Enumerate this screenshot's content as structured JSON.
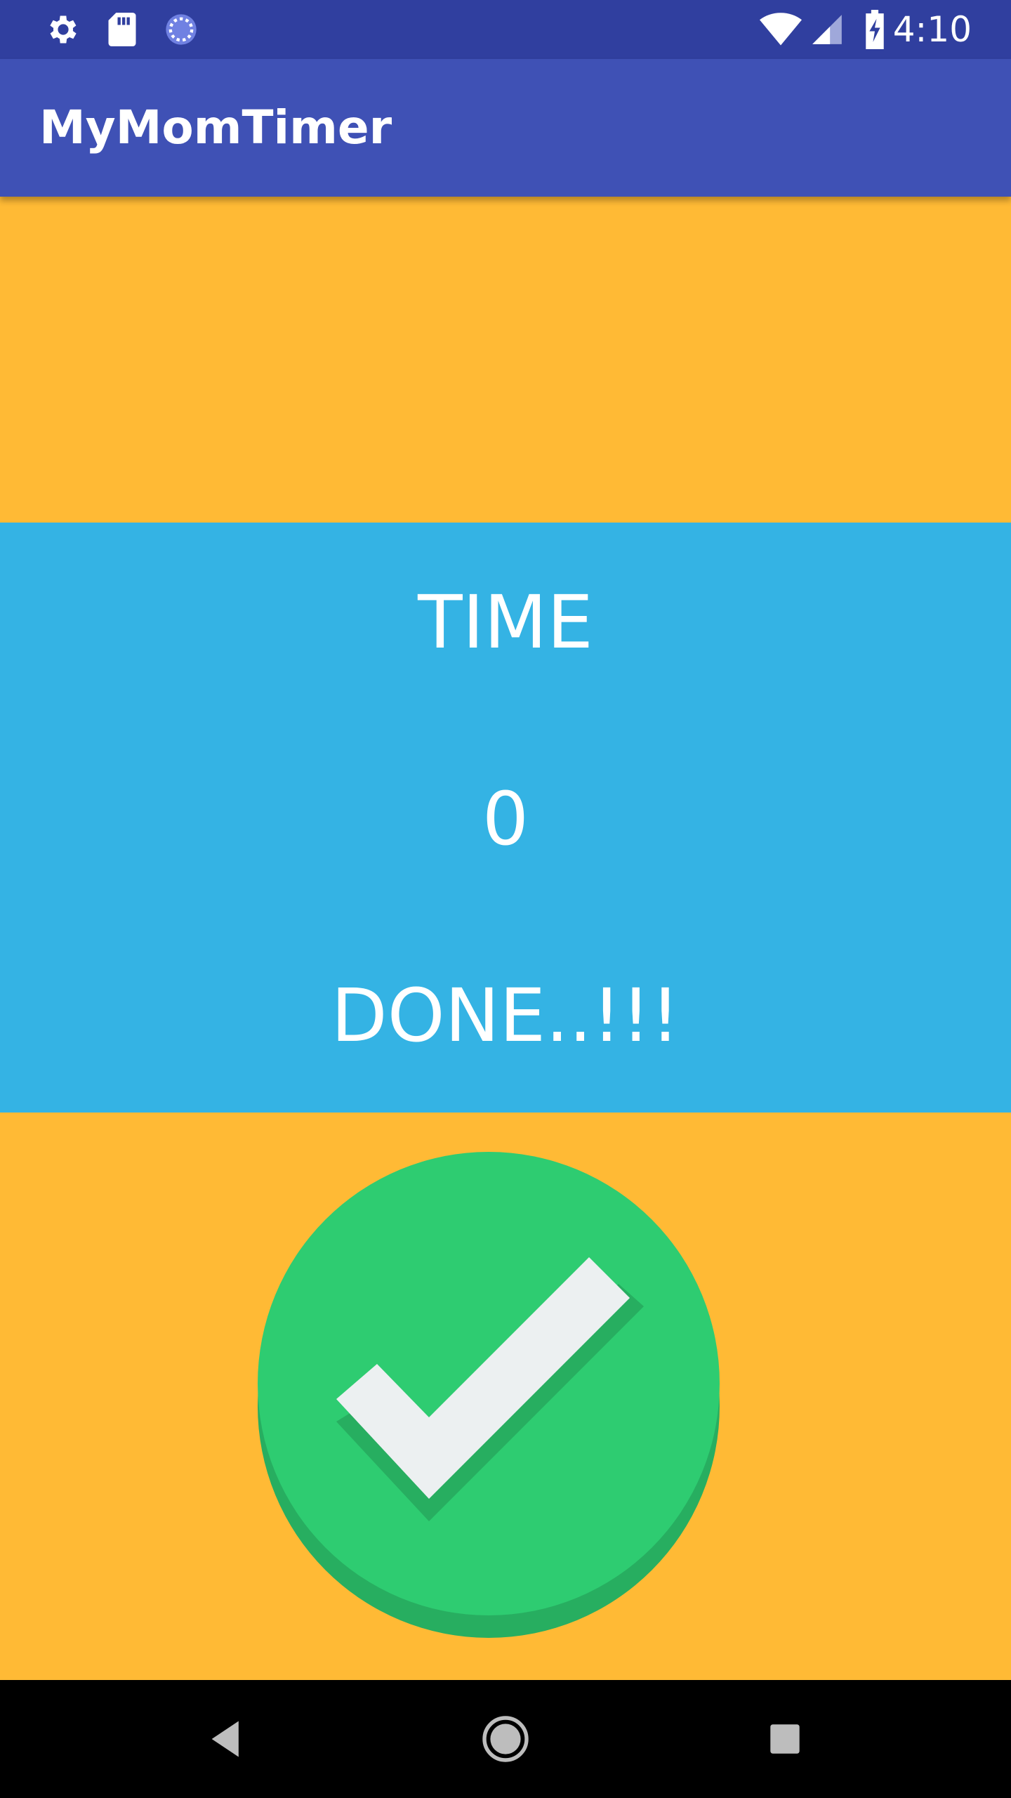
{
  "status_bar": {
    "time": "4:10",
    "icons_left": [
      "settings-icon",
      "sd-card-icon",
      "sync-icon"
    ],
    "icons_right": [
      "wifi-icon",
      "cell-signal-icon",
      "battery-charging-icon"
    ]
  },
  "app_bar": {
    "title": "MyMomTimer"
  },
  "timer": {
    "label": "TIME",
    "value": "0",
    "status": "DONE..!!!"
  },
  "colors": {
    "status_bar": "#303F9F",
    "app_bar": "#3F51B5",
    "orange_bg": "#FFBA35",
    "blue_panel": "#34B3E4",
    "check_green": "#2ECC71",
    "check_shadow": "#27AE60",
    "check_mark": "#ECF0F1"
  },
  "nav_bar": {
    "buttons": [
      "back-icon",
      "home-icon",
      "recents-icon"
    ]
  }
}
